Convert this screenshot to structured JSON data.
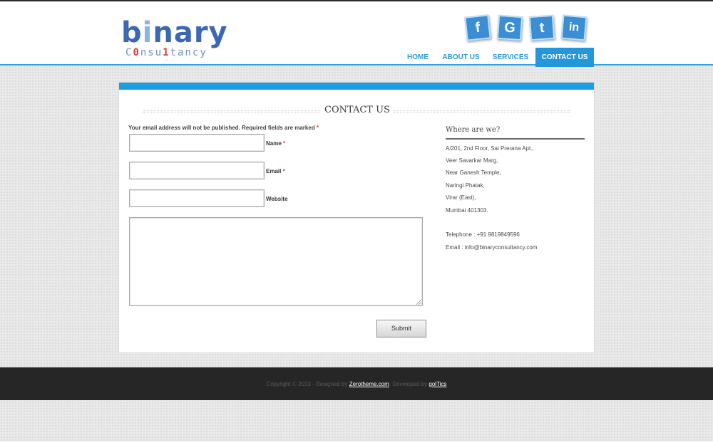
{
  "logo": {
    "word_part1": "b",
    "word_part2": "i",
    "word_part3": "nary",
    "tag_part1": "C",
    "tag_part2": "0",
    "tag_part3": "nsu",
    "tag_part4": "1",
    "tag_part5": "tancy"
  },
  "social": {
    "facebook": "f",
    "google": "G",
    "twitter": "t",
    "linkedin": "in"
  },
  "nav": [
    "HOME",
    "ABOUT US",
    "SERVICES",
    "CONTACT US"
  ],
  "page_title": "CONTACT US",
  "form": {
    "note": "Your email address will not be published. Required fields are marked",
    "required_mark": "*",
    "name_label": "Name",
    "email_label": "Email",
    "website_label": "Website",
    "submit_label": "Submit"
  },
  "sidebar": {
    "title": "Where are we?",
    "address": [
      "A/201, 2nd Floor, Sai Prerana Apt.,",
      "Veer Savarkar Marg,",
      "Near Ganesh Temple,",
      "Naringi Phatak,",
      "Virar (East),",
      "Mumbai 401303."
    ],
    "telephone": "Telephone : +91 9819849596",
    "email": "Email : info@binaryconsultancy.com"
  },
  "footer": {
    "copyright": "Copyright © 2013 - Designed by",
    "designer": "Zerotheme.com",
    "developed": ". Developed by",
    "developer": "golTics"
  },
  "colors": {
    "accent": "#2497db",
    "footer_bg": "#262626",
    "logo_blue": "#3b67b5",
    "logo_red": "#d9403a"
  }
}
